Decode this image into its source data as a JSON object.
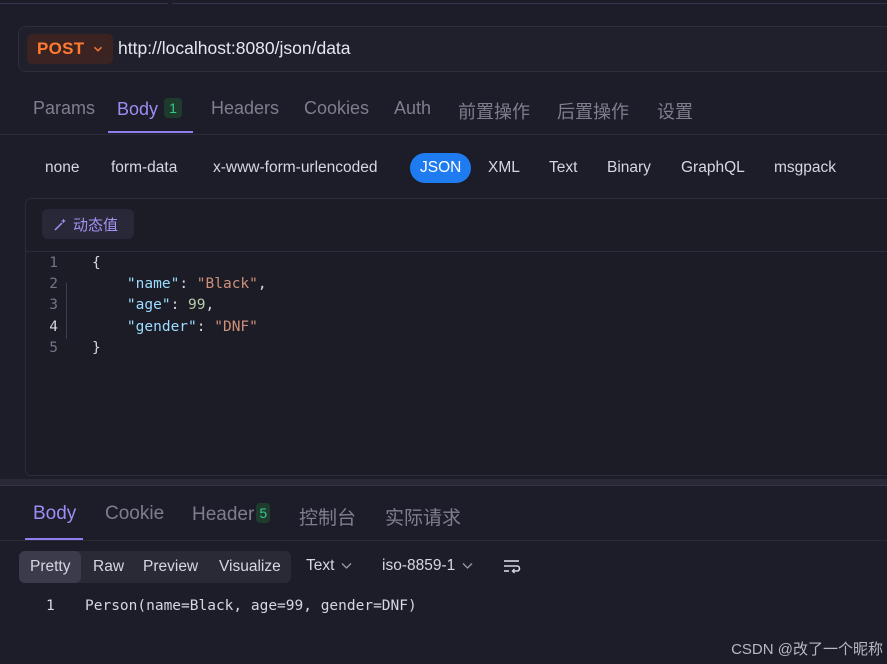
{
  "request": {
    "method": "POST",
    "url": "http://localhost:8080/json/data"
  },
  "request_tabs": [
    {
      "label": "Params"
    },
    {
      "label": "Body",
      "badge": "1"
    },
    {
      "label": "Headers"
    },
    {
      "label": "Cookies"
    },
    {
      "label": "Auth"
    },
    {
      "label": "前置操作"
    },
    {
      "label": "后置操作"
    },
    {
      "label": "设置"
    }
  ],
  "body_types": [
    "none",
    "form-data",
    "x-www-form-urlencoded",
    "JSON",
    "XML",
    "Text",
    "Binary",
    "GraphQL",
    "msgpack"
  ],
  "body_type_selected": "JSON",
  "editor": {
    "dynamic_value_label": "动态值",
    "line_numbers": [
      "1",
      "2",
      "3",
      "4",
      "5"
    ],
    "lines": [
      [
        {
          "t": "p",
          "v": "{"
        }
      ],
      [
        {
          "t": "p",
          "v": "    "
        },
        {
          "t": "k",
          "v": "\"name\""
        },
        {
          "t": "p",
          "v": ": "
        },
        {
          "t": "s",
          "v": "\"Black\""
        },
        {
          "t": "p",
          "v": ","
        }
      ],
      [
        {
          "t": "p",
          "v": "    "
        },
        {
          "t": "k",
          "v": "\"age\""
        },
        {
          "t": "p",
          "v": ": "
        },
        {
          "t": "n",
          "v": "99"
        },
        {
          "t": "p",
          "v": ","
        }
      ],
      [
        {
          "t": "p",
          "v": "    "
        },
        {
          "t": "k",
          "v": "\"gender\""
        },
        {
          "t": "p",
          "v": ": "
        },
        {
          "t": "s",
          "v": "\"DNF\""
        }
      ],
      [
        {
          "t": "p",
          "v": "}"
        }
      ]
    ]
  },
  "response_tabs": [
    {
      "label": "Body"
    },
    {
      "label": "Cookie"
    },
    {
      "label": "Header",
      "badge": "5"
    },
    {
      "label": "控制台"
    },
    {
      "label": "实际请求"
    }
  ],
  "response_view": {
    "modes": [
      "Pretty",
      "Raw",
      "Preview",
      "Visualize"
    ],
    "selected_mode": "Pretty",
    "format": "Text",
    "encoding": "iso-8859-1"
  },
  "response_body": {
    "line_number": "1",
    "text": "Person(name=Black, age=99, gender=DNF)"
  },
  "watermark": "CSDN @改了一个昵称",
  "colors": {
    "background": "#1d1d29",
    "method": "#ff7a33",
    "accent": "#9c8cf4",
    "selected_pill": "#1f7cf0",
    "badge": "#38c88a"
  }
}
